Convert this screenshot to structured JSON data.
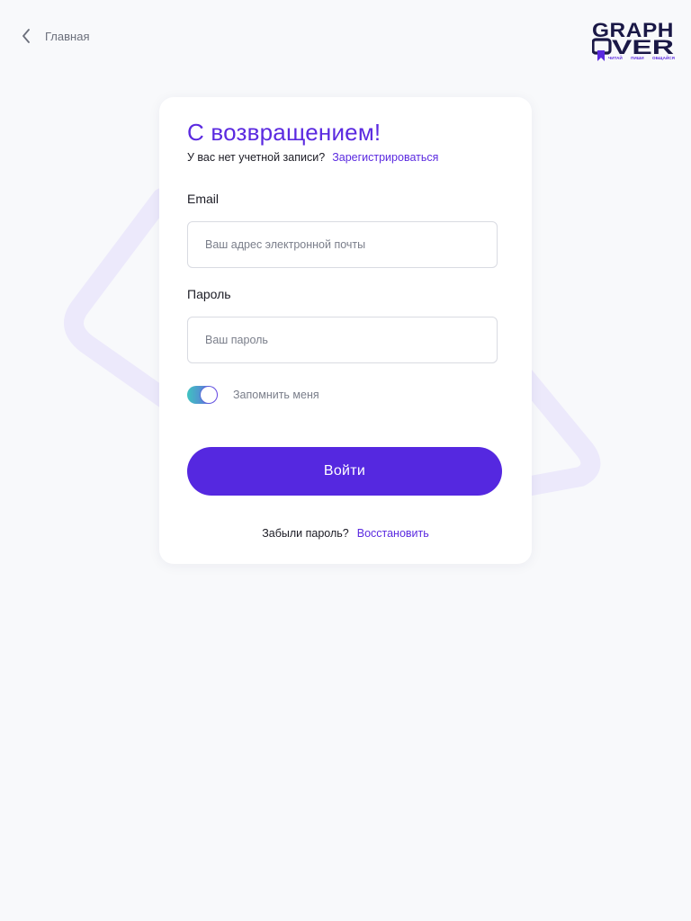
{
  "nav": {
    "back_label": "Главная"
  },
  "logo": {
    "line1": "GRAPH",
    "line2": "VER",
    "tagline": [
      "ЧИТАЙ",
      "ПИШИ",
      "ОБЩАЙСЯ"
    ]
  },
  "login": {
    "title": "С возвращением!",
    "no_account_text": "У вас нет учетной записи?",
    "register_link": "Зарегистрироваться",
    "email_label": "Email",
    "email_placeholder": "Ваш адрес электронной почты",
    "email_value": "",
    "password_label": "Пароль",
    "password_placeholder": "Ваш пароль",
    "password_value": "",
    "remember_label": "Запомнить меня",
    "remember_checked": true,
    "submit_label": "Войти",
    "forgot_text": "Забыли пароль?",
    "restore_link": "Восстановить"
  },
  "colors": {
    "accent": "#5528e0",
    "background": "#f8f9fb",
    "card": "#ffffff",
    "toggle_start": "#3ec3c0",
    "toggle_end": "#6d55e6",
    "logo_dark": "#1a1846"
  }
}
